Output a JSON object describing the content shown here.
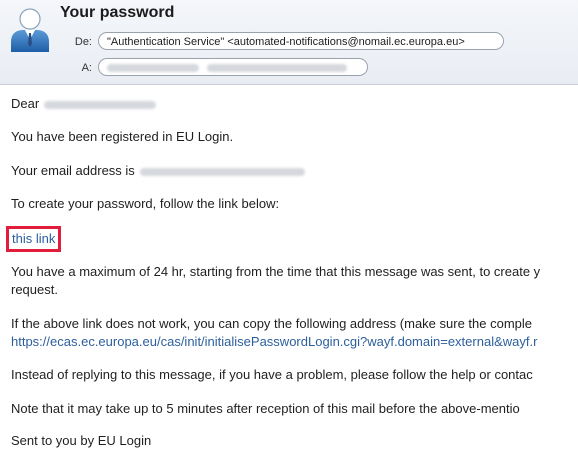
{
  "header": {
    "subject": "Your password",
    "from_label": "De:",
    "from_value": "\"Authentication Service\" <automated-notifications@nomail.ec.europa.eu>",
    "to_label": "A:"
  },
  "body": {
    "greeting": "Dear",
    "line_registered": "You have been registered in EU Login.",
    "line_email_prefix": "Your email address is",
    "line_create": "To create your password, follow the link below:",
    "link_text": "this link",
    "line_maximum": "You have a maximum of 24 hr, starting from the time that this message was sent, to create y",
    "line_request": "request.",
    "line_if_link": "If the above link does not work, you can copy the following address (make sure the comple",
    "address_link": "https://ecas.ec.europa.eu/cas/init/initialisePasswordLogin.cgi?wayf.domain=external&wayf.r",
    "line_instead": "Instead of replying to this message, if you have a problem, please follow the help or contac",
    "line_note": "Note that it may take up to 5 minutes after reception of this mail before the above-mentio",
    "line_sent": "Sent to you by EU Login"
  },
  "colors": {
    "link": "#2c5f9e",
    "highlight_box": "#e21d3b"
  }
}
